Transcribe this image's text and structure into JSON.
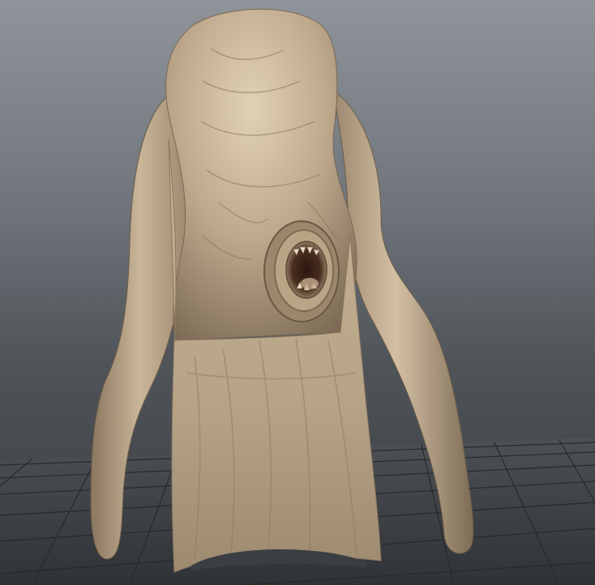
{
  "viewport": {
    "background_top": "#8e949a",
    "background_bottom": "#3a3d41",
    "grid_color": "#2a2d31",
    "ground_color": "#45484c"
  },
  "model": {
    "material_color": "#bba78c",
    "shadow_color": "#6e5f4c",
    "highlight_color": "#e6d6bd",
    "mouth_color": "#3a2418"
  }
}
